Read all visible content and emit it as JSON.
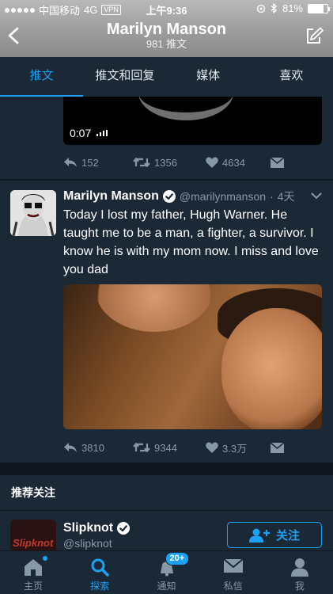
{
  "status_bar": {
    "carrier": "中国移动",
    "network": "4G",
    "vpn": "VPN",
    "time": "上午9:36",
    "battery": "81%",
    "battery_level": 0.81,
    "signal_bars_filled": 5
  },
  "header": {
    "title": "Marilyn Manson",
    "subtitle": "981 推文"
  },
  "tabs": [
    {
      "label": "推文",
      "active": true
    },
    {
      "label": "推文和回复",
      "active": false
    },
    {
      "label": "媒体",
      "active": false
    },
    {
      "label": "喜欢",
      "active": false
    }
  ],
  "prev_tweet": {
    "video_duration": "0:07",
    "replies": "152",
    "retweets": "1356",
    "likes": "4634"
  },
  "tweet": {
    "display_name": "Marilyn Manson",
    "handle": "@marilynmanson",
    "time_sep": "·",
    "time": "4天",
    "text": "Today I lost my father, Hugh Warner. He taught me to be a man, a fighter, a survivor. I know he is with my mom now. I miss and love you dad",
    "replies": "3810",
    "retweets": "9344",
    "likes": "3.3万"
  },
  "suggestions": {
    "title": "推荐关注",
    "items": [
      {
        "name": "Slipknot",
        "handle": "@slipknot",
        "avatar_text": "Slipknot",
        "follow_label": "关注"
      }
    ]
  },
  "tabbar": {
    "items": [
      {
        "label": "主页",
        "icon": "home-icon",
        "active": false
      },
      {
        "label": "探索",
        "icon": "search-icon",
        "active": true
      },
      {
        "label": "通知",
        "icon": "bell-icon",
        "active": false,
        "badge": "20+"
      },
      {
        "label": "私信",
        "icon": "mail-icon",
        "active": false
      },
      {
        "label": "我",
        "icon": "profile-icon",
        "active": false
      }
    ]
  },
  "colors": {
    "accent": "#1da1f2",
    "background": "#141d26",
    "card": "#1b2836",
    "muted": "#8899a6"
  }
}
